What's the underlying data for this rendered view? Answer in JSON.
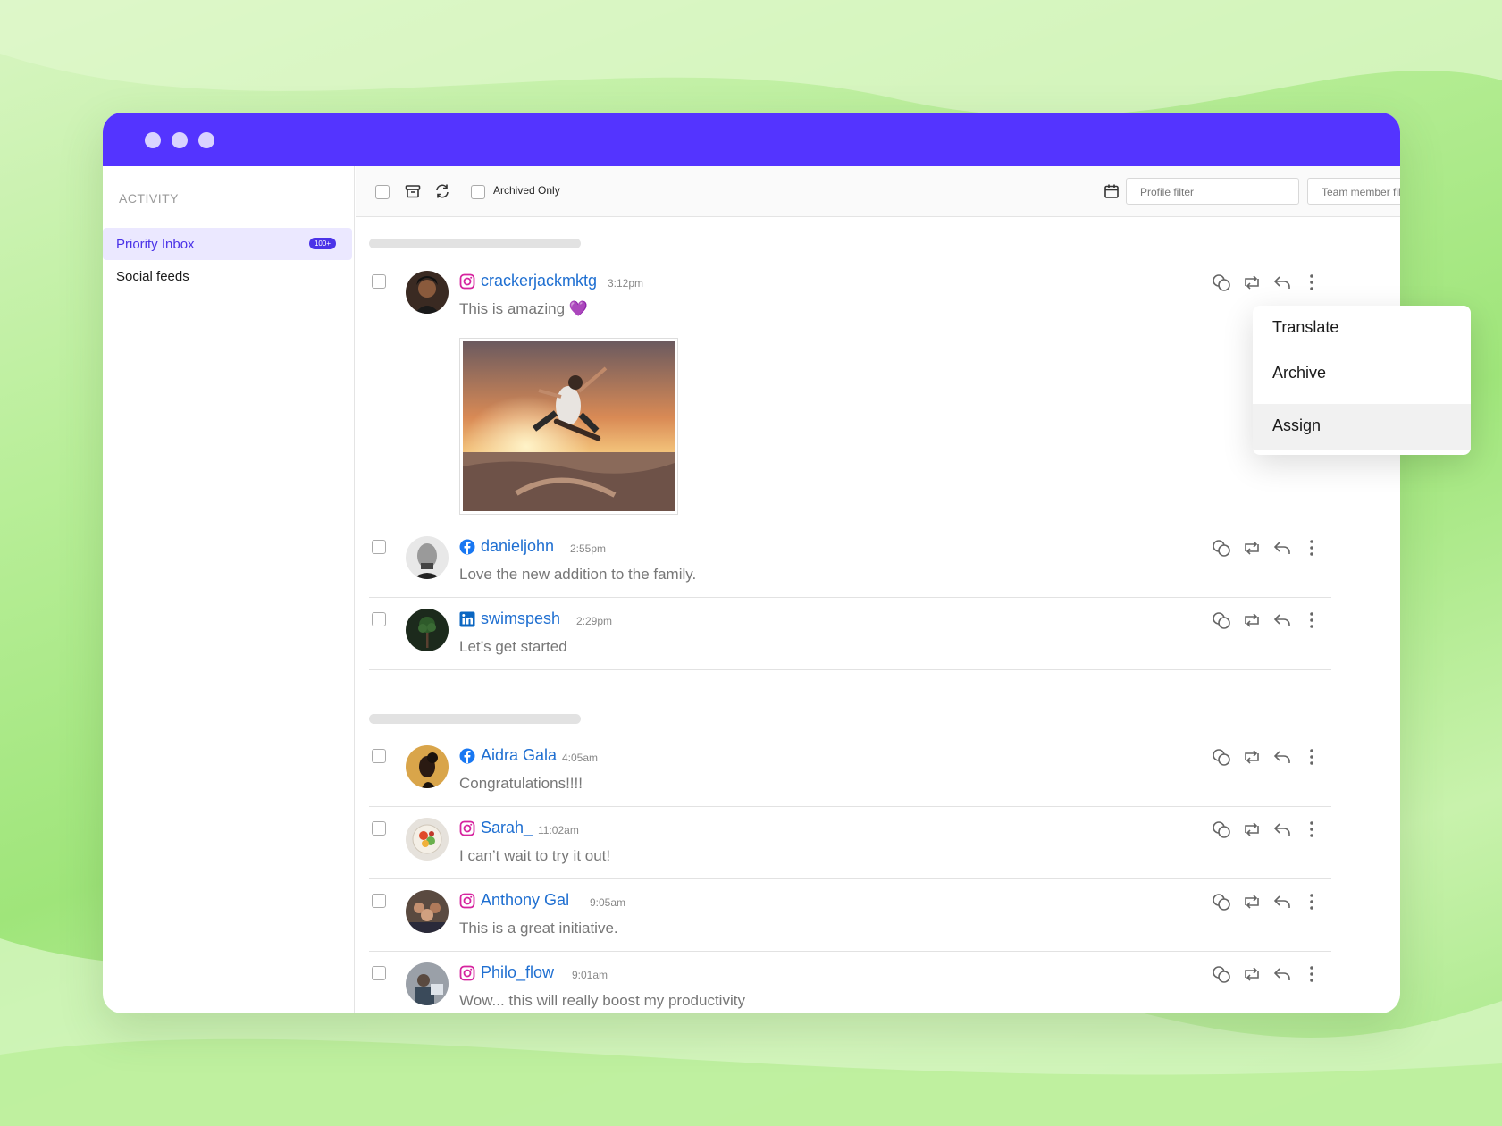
{
  "sidebar": {
    "section_title": "ACTIVITY",
    "items": [
      {
        "label": "Priority Inbox",
        "badge": "100+",
        "active": true
      },
      {
        "label": "Social feeds",
        "active": false
      }
    ]
  },
  "toolbar": {
    "archived_only_label": "Archived Only",
    "profile_filter_placeholder": "Profile filter",
    "team_member_filter_placeholder": "Team member filter"
  },
  "messages": [
    {
      "network": "instagram",
      "username": "crackerjackmktg",
      "time": "3:12pm",
      "text": "This is amazing 💜",
      "has_image": true
    },
    {
      "network": "facebook",
      "username": "danieljohn",
      "time": "2:55pm",
      "text": "Love the new addition to the family."
    },
    {
      "network": "linkedin",
      "username": "swimspesh",
      "time": "2:29pm",
      "text": "Let’s get started"
    },
    {
      "network": "facebook",
      "username": "Aidra Gala",
      "time": "4:05am",
      "text": "Congratulations!!!!"
    },
    {
      "network": "instagram",
      "username": "Sarah_",
      "time": "11:02am",
      "text": "I can’t wait to try it out!"
    },
    {
      "network": "instagram",
      "username": "Anthony Gal",
      "time": "9:05am",
      "text": "This is a great initiative."
    },
    {
      "network": "instagram",
      "username": "Philo_flow",
      "time": "9:01am",
      "text": "Wow... this will really boost my productivity"
    }
  ],
  "context_menu": {
    "items": [
      "Translate",
      "Archive",
      "Assign"
    ],
    "highlighted": "Assign"
  },
  "colors": {
    "titlebar": "#5434ff",
    "accent": "#4b33e8",
    "username": "#1f6fd1",
    "instagram": "#d6249f",
    "facebook": "#1877f2",
    "linkedin": "#0a66c2"
  },
  "icons": {
    "row_actions": [
      "translate-icon",
      "retweet-icon",
      "reply-icon",
      "more-vertical-icon"
    ],
    "toolbar": [
      "archive-box-icon",
      "refresh-icon",
      "calendar-icon",
      "search-icon"
    ]
  }
}
